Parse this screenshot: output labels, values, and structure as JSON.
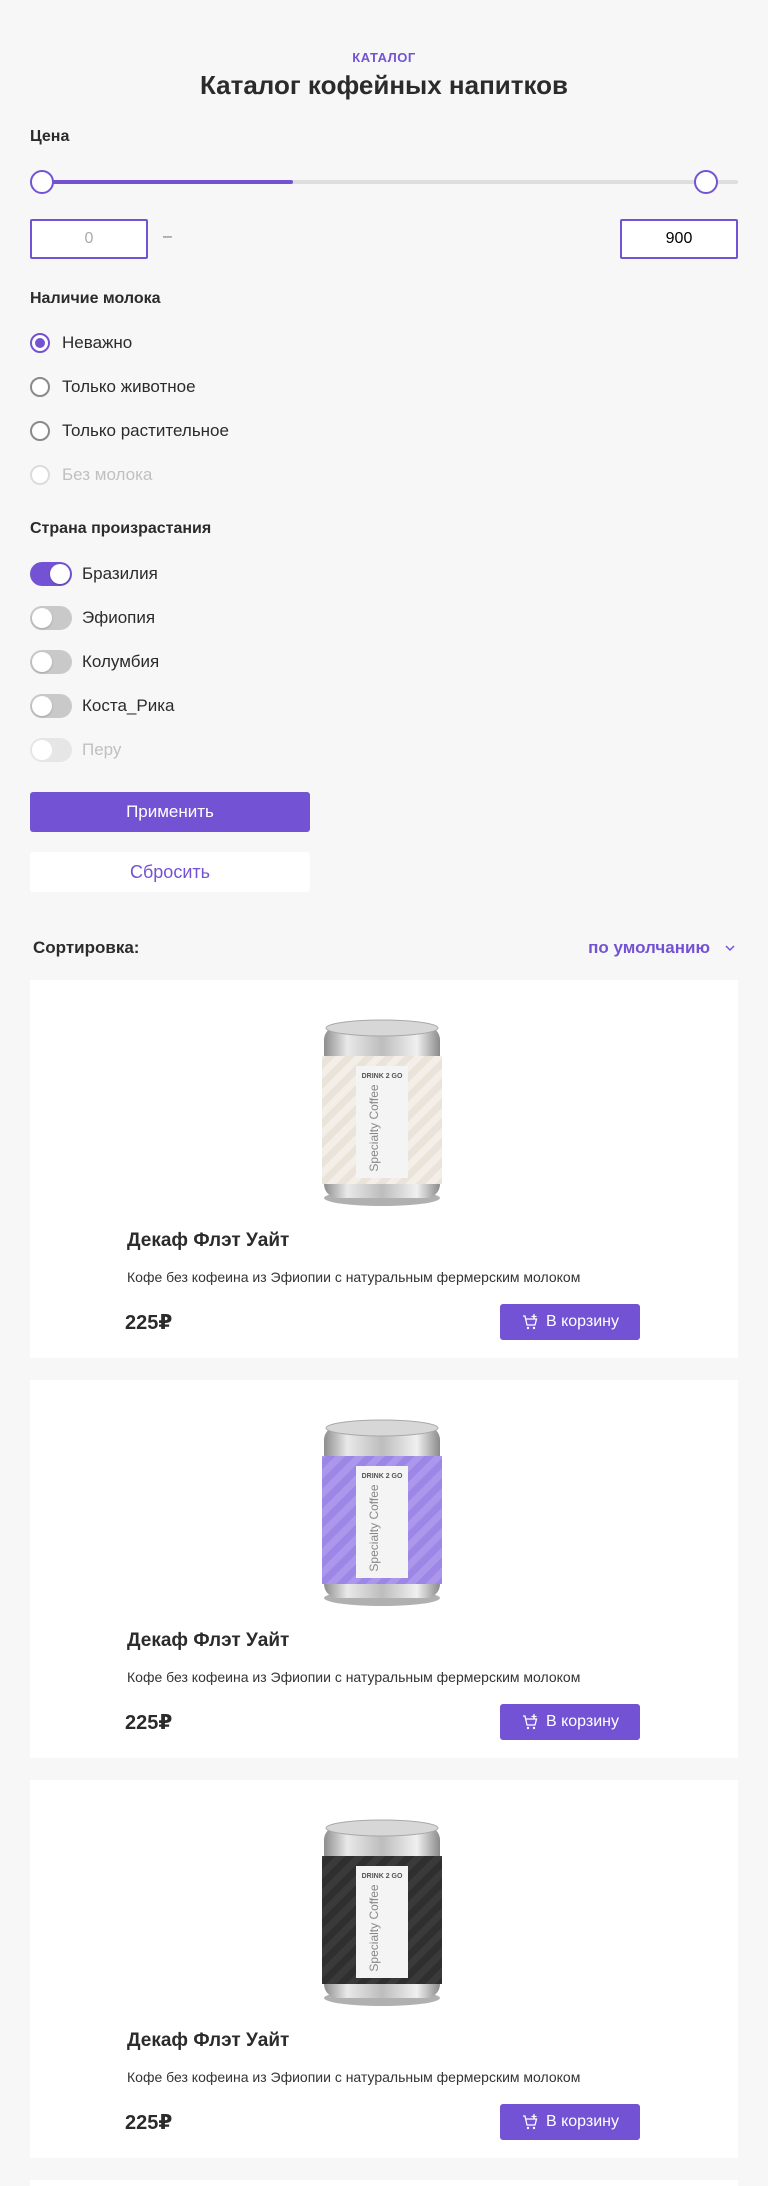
{
  "header": {
    "eyebrow": "КАТАЛОГ",
    "title": "Каталог кофейных напитков"
  },
  "filters": {
    "price": {
      "title": "Цена",
      "min_placeholder": "0",
      "max_value": "900",
      "separator": "–",
      "range_fill_fraction": 0.36
    },
    "milk": {
      "title": "Наличие молока",
      "options": [
        {
          "label": "Неважно",
          "checked": true,
          "disabled": false
        },
        {
          "label": "Только животное",
          "checked": false,
          "disabled": false
        },
        {
          "label": "Только растительное",
          "checked": false,
          "disabled": false
        },
        {
          "label": "Без молока",
          "checked": false,
          "disabled": true
        }
      ]
    },
    "country": {
      "title": "Страна произрастания",
      "options": [
        {
          "label": "Бразилия",
          "on": true,
          "disabled": false
        },
        {
          "label": "Эфиопия",
          "on": false,
          "disabled": false
        },
        {
          "label": "Колумбия",
          "on": false,
          "disabled": false
        },
        {
          "label": "Коста_Рика",
          "on": false,
          "disabled": false
        },
        {
          "label": "Перу",
          "on": false,
          "disabled": true
        }
      ]
    },
    "apply_label": "Применить",
    "reset_label": "Сбросить"
  },
  "sort": {
    "label": "Сортировка:",
    "value": "по умолчанию"
  },
  "products": [
    {
      "name": "Декаф Флэт Уайт",
      "description": "Кофе без кофеина из Эфиопии с натуральным фермерским молоком",
      "price": "225₽",
      "cart_label": "В корзину",
      "can_brand": "DRINK 2 GO",
      "can_text": "Specialty Coffee",
      "label_color": "#e9e3da",
      "stripe_color": "#f3efe8"
    },
    {
      "name": "Декаф Флэт Уайт",
      "description": "Кофе без кофеина из Эфиопии с натуральным фермерским молоком",
      "price": "225₽",
      "cart_label": "В корзину",
      "can_brand": "DRINK 2 GO",
      "can_text": "Specialty Coffee",
      "label_color": "#9c86e6",
      "stripe_color": "#ab98ec"
    },
    {
      "name": "Декаф Флэт Уайт",
      "description": "Кофе без кофеина из Эфиопии с натуральным фермерским молоком",
      "price": "225₽",
      "cart_label": "В корзину",
      "can_brand": "DRINK 2 GO",
      "can_text": "Specialty Coffee",
      "label_color": "#2f2f2f",
      "stripe_color": "#3a3a3a"
    }
  ],
  "colors": {
    "accent": "#7353d3",
    "background": "#f7f7f7"
  }
}
